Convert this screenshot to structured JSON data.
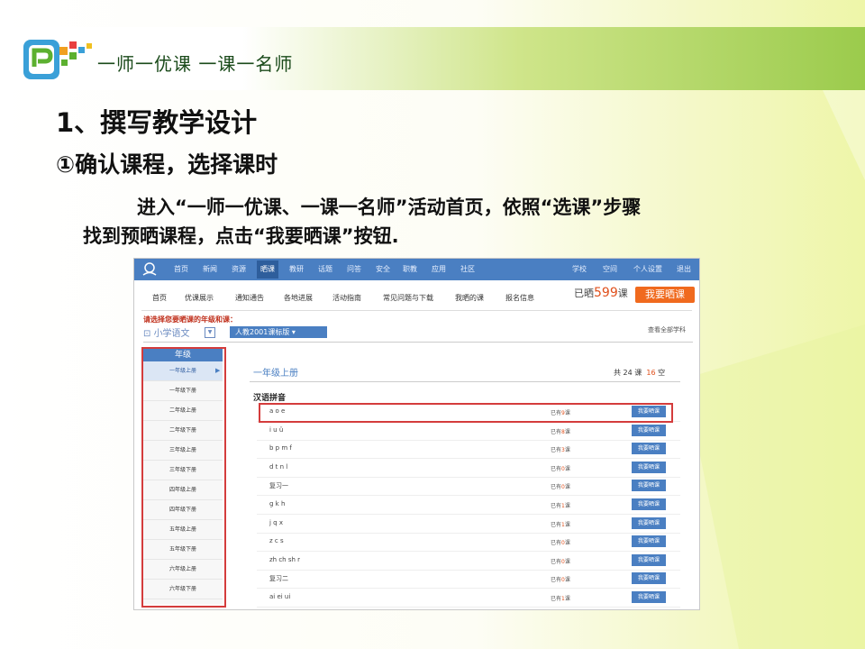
{
  "slide": {
    "logo_text": "一师一优课 一课一名师",
    "heading": "1、撰写教学设计",
    "subheading": "①确认课程，选择课时",
    "paragraph_line1": "进入“一师一优课、一课一名师”活动首页，依照“选课”步骤",
    "paragraph_line2": "找到预晒课程，点击“我要晒课”按钮."
  },
  "site": {
    "top_nav": [
      "首页",
      "新闻",
      "资源",
      "晒课",
      "教研",
      "话题",
      "问答",
      "安全",
      "职教",
      "应用",
      "社区"
    ],
    "top_nav_active_index": 3,
    "top_right": [
      "学校",
      "空间",
      "个人设置",
      "退出"
    ],
    "sub_nav": [
      "首页",
      "优课展示",
      "通知通告",
      "各地进展",
      "活动指南",
      "常见问题与下载",
      "我晒的课",
      "报名信息"
    ],
    "shared_prefix": "已晒",
    "shared_number": "599",
    "shared_unit": "课",
    "share_button": "我要晒课",
    "prompt": "请选择您要晒课的年级和课：",
    "subject": "小学语文",
    "edition": "人教2001课标版",
    "view_all": "查看全部学科",
    "grade_header": "年级",
    "grades": [
      "一年级上册",
      "一年级下册",
      "二年级上册",
      "二年级下册",
      "三年级上册",
      "三年级下册",
      "四年级上册",
      "四年级下册",
      "五年级上册",
      "五年级下册",
      "六年级上册",
      "六年级下册"
    ],
    "active_grade_index": 0,
    "section_title": "一年级上册",
    "total_prefix": "共 24 课",
    "total_highlight": "16",
    "total_suffix": "空",
    "unit_title": "汉语拼音",
    "lessons": [
      {
        "name": "a  o  e",
        "prefix": "已有",
        "count": "9",
        "suffix": "课",
        "button": "我要晒课"
      },
      {
        "name": "i  u  ü",
        "prefix": "已有",
        "count": "8",
        "suffix": "课",
        "button": "我要晒课"
      },
      {
        "name": "b p m f",
        "prefix": "已有",
        "count": "3",
        "suffix": "课",
        "button": "我要晒课"
      },
      {
        "name": "d t n l",
        "prefix": "已有",
        "count": "0",
        "suffix": "课",
        "button": "我要晒课"
      },
      {
        "name": "复习一",
        "prefix": "已有",
        "count": "0",
        "suffix": "课",
        "button": "我要晒课"
      },
      {
        "name": "g k h",
        "prefix": "已有",
        "count": "1",
        "suffix": "课",
        "button": "我要晒课"
      },
      {
        "name": "j q x",
        "prefix": "已有",
        "count": "1",
        "suffix": "课",
        "button": "我要晒课"
      },
      {
        "name": "z c s",
        "prefix": "已有",
        "count": "0",
        "suffix": "课",
        "button": "我要晒课"
      },
      {
        "name": "zh ch sh  r",
        "prefix": "已有",
        "count": "0",
        "suffix": "课",
        "button": "我要晒课"
      },
      {
        "name": "复习二",
        "prefix": "已有",
        "count": "0",
        "suffix": "课",
        "button": "我要晒课"
      },
      {
        "name": "ai ei ui",
        "prefix": "已有",
        "count": "1",
        "suffix": "课",
        "button": "我要晒课"
      }
    ]
  },
  "colors": {
    "accent_blue": "#4a7fc2",
    "orange": "#f06a1e",
    "highlight_red": "#d43c3c",
    "banner_green": "#9bcb4c"
  }
}
